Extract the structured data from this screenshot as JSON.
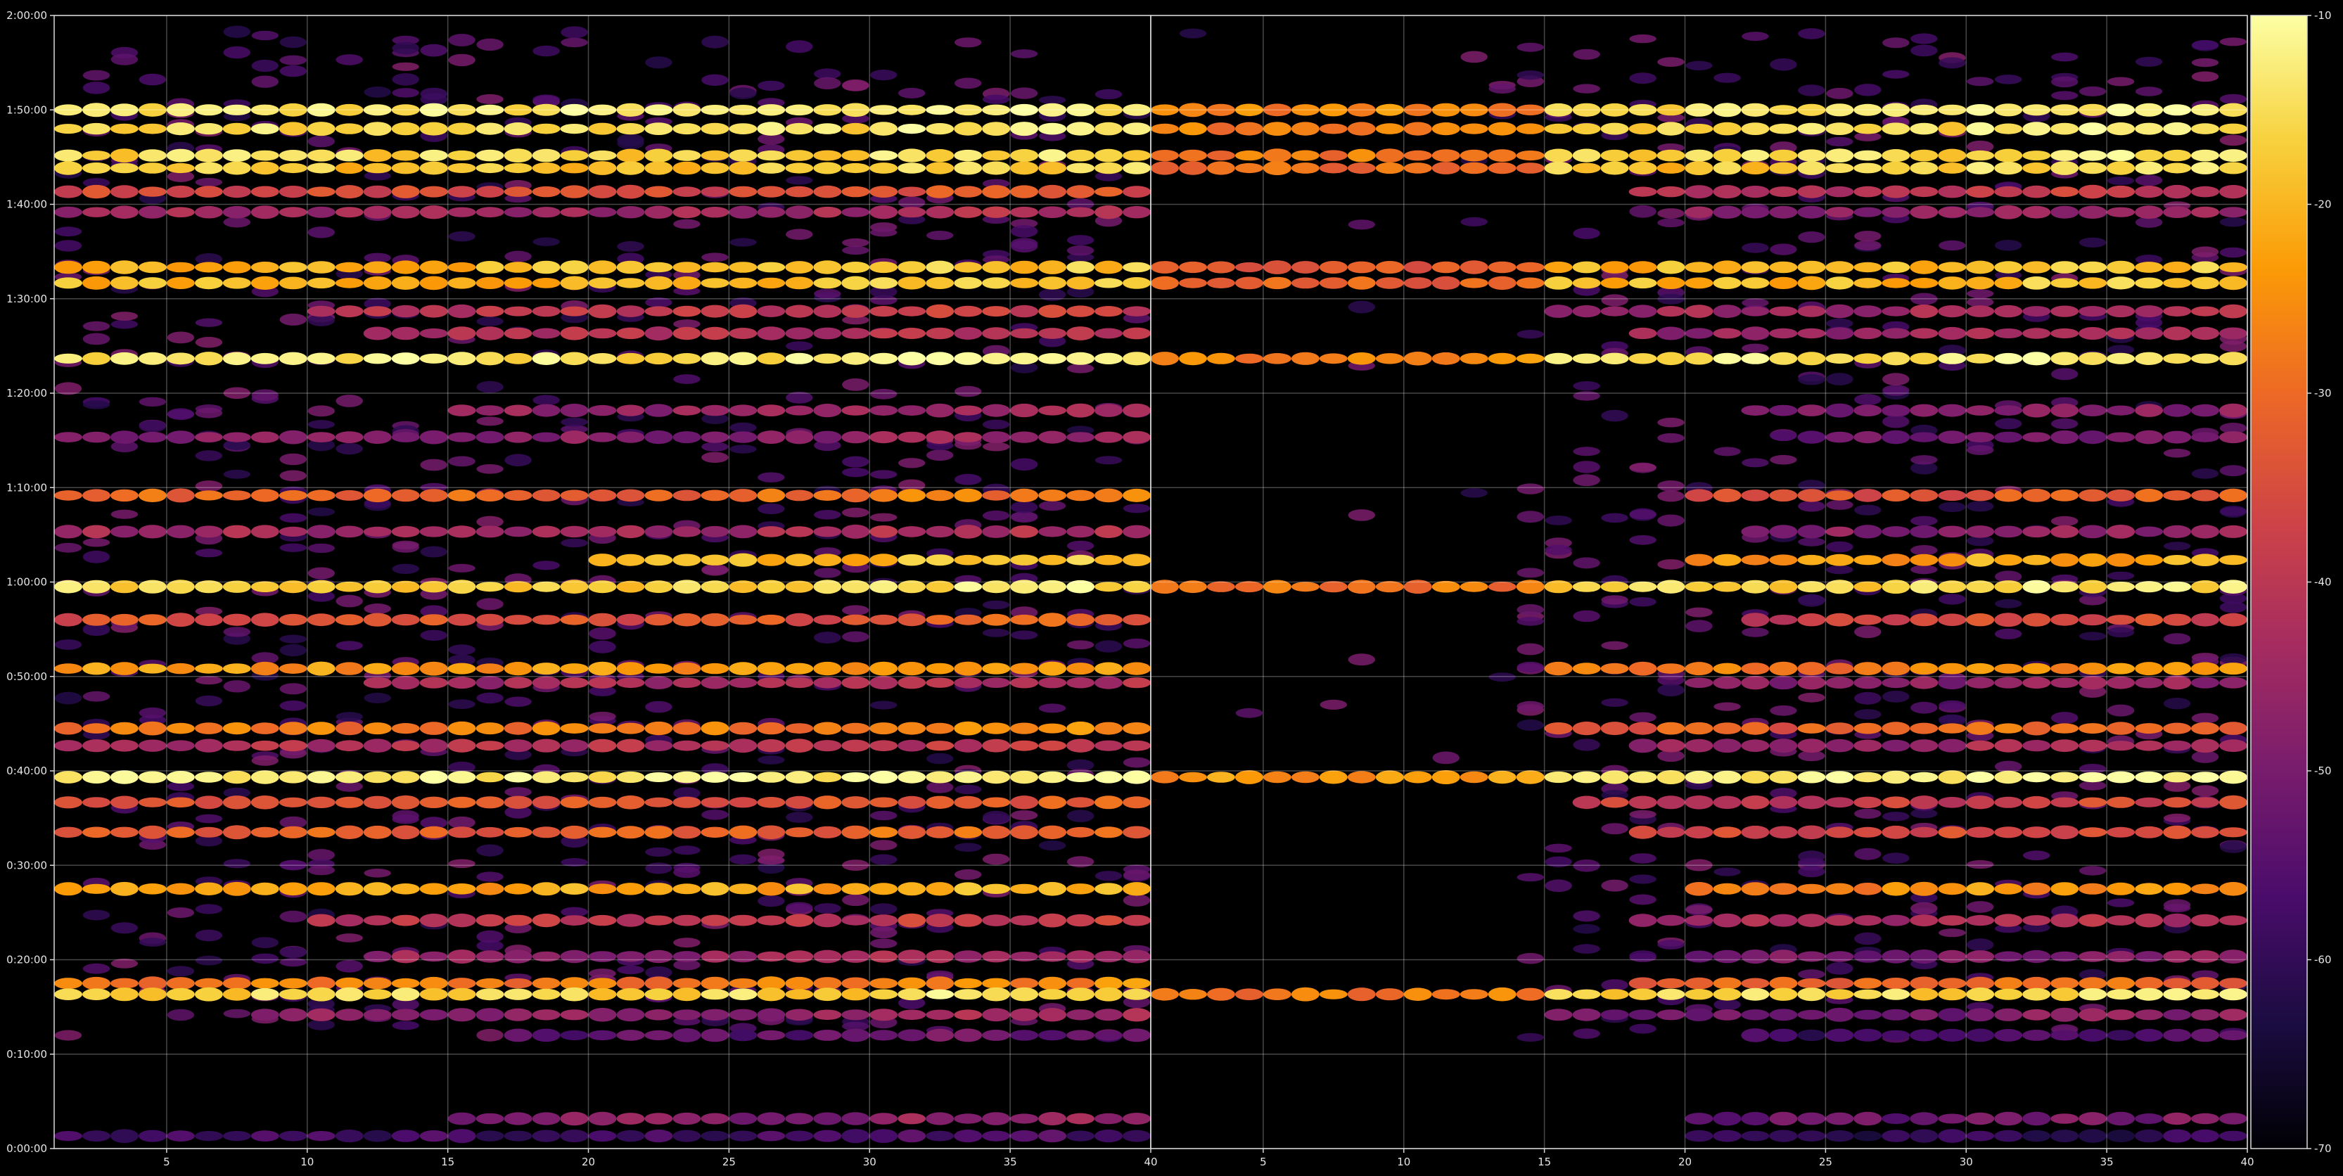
{
  "chart_data": {
    "type": "heatmap",
    "title": "",
    "xlabel": "",
    "ylabel": "",
    "grid": true,
    "colormap": "inferno",
    "colormap_stops": [
      "#000004",
      "#1b0c41",
      "#4a0c6b",
      "#781c6d",
      "#a52c60",
      "#cf4446",
      "#ed6925",
      "#fb9b06",
      "#f7d13d",
      "#fcffa4"
    ],
    "panels": [
      {
        "name": "left",
        "xlim": [
          1,
          40
        ],
        "xticks": [
          5,
          10,
          15,
          20,
          25,
          30,
          35,
          40
        ]
      },
      {
        "name": "right",
        "xlim": [
          1,
          40
        ],
        "xticks": [
          5,
          10,
          15,
          20,
          25,
          30,
          35,
          40
        ]
      }
    ],
    "ylim_seconds": [
      0,
      7200
    ],
    "yticks": [
      {
        "value": 0,
        "label": "0:00:00"
      },
      {
        "value": 600,
        "label": "0:10:00"
      },
      {
        "value": 1200,
        "label": "0:20:00"
      },
      {
        "value": 1800,
        "label": "0:30:00"
      },
      {
        "value": 2400,
        "label": "0:40:00"
      },
      {
        "value": 3000,
        "label": "0:50:00"
      },
      {
        "value": 3600,
        "label": "1:00:00"
      },
      {
        "value": 4200,
        "label": "1:10:00"
      },
      {
        "value": 4800,
        "label": "1:20:00"
      },
      {
        "value": 5400,
        "label": "1:30:00"
      },
      {
        "value": 6000,
        "label": "1:40:00"
      },
      {
        "value": 6600,
        "label": "1:50:00"
      },
      {
        "value": 7200,
        "label": "2:00:00"
      }
    ],
    "colorbar": {
      "range": [
        -70,
        -10
      ],
      "ticks": [
        -10,
        -20,
        -30,
        -40,
        -50,
        -60,
        -70
      ]
    },
    "bands": [
      {
        "t": 6600,
        "base": -14,
        "start": 1,
        "right_start": 1
      },
      {
        "t": 6480,
        "base": -15,
        "start": 1,
        "right_start": 1
      },
      {
        "t": 6310,
        "base": -16,
        "start": 1,
        "right_start": 1
      },
      {
        "t": 6230,
        "base": -18,
        "start": 1,
        "right_start": 1
      },
      {
        "t": 6080,
        "base": -36,
        "start": 1,
        "right_start": 18
      },
      {
        "t": 5950,
        "base": -44,
        "start": 1,
        "right_start": 20
      },
      {
        "t": 5600,
        "base": -20,
        "start": 1,
        "right_start": 1
      },
      {
        "t": 5500,
        "base": -20,
        "start": 1,
        "right_start": 1
      },
      {
        "t": 5320,
        "base": -40,
        "start": 10,
        "right_start": 15
      },
      {
        "t": 5180,
        "base": -42,
        "start": 12,
        "right_start": 18
      },
      {
        "t": 5020,
        "base": -14,
        "start": 1,
        "right_start": 1
      },
      {
        "t": 4690,
        "base": -46,
        "start": 15,
        "right_start": 22
      },
      {
        "t": 4520,
        "base": -48,
        "start": 1,
        "right_start": 24
      },
      {
        "t": 4150,
        "base": -30,
        "start": 1,
        "right_start": 20
      },
      {
        "t": 3920,
        "base": -44,
        "start": 1,
        "right_start": 22
      },
      {
        "t": 3740,
        "base": -20,
        "start": 20,
        "right_start": 20
      },
      {
        "t": 3570,
        "base": -16,
        "start": 1,
        "right_start": 1
      },
      {
        "t": 3360,
        "base": -34,
        "start": 1,
        "right_start": 22
      },
      {
        "t": 3050,
        "base": -24,
        "start": 1,
        "right_start": 15
      },
      {
        "t": 2960,
        "base": -44,
        "start": 12,
        "right_start": 20
      },
      {
        "t": 2670,
        "base": -28,
        "start": 1,
        "right_start": 15
      },
      {
        "t": 2560,
        "base": -42,
        "start": 1,
        "right_start": 18
      },
      {
        "t": 2360,
        "base": -12,
        "start": 1,
        "right_start": 1
      },
      {
        "t": 2200,
        "base": -34,
        "start": 1,
        "right_start": 16
      },
      {
        "t": 2010,
        "base": -32,
        "start": 1,
        "right_start": 18
      },
      {
        "t": 1650,
        "base": -22,
        "start": 1,
        "right_start": 20
      },
      {
        "t": 1450,
        "base": -40,
        "start": 10,
        "right_start": 18
      },
      {
        "t": 1220,
        "base": -46,
        "start": 12,
        "right_start": 20
      },
      {
        "t": 1050,
        "base": -28,
        "start": 1,
        "right_start": 18
      },
      {
        "t": 980,
        "base": -16,
        "start": 1,
        "right_start": 1
      },
      {
        "t": 850,
        "base": -46,
        "start": 8,
        "right_start": 15
      },
      {
        "t": 720,
        "base": -54,
        "start": 17,
        "right_start": 22
      },
      {
        "t": 190,
        "base": -48,
        "start": 15,
        "right_start": 20
      },
      {
        "t": 80,
        "base": -58,
        "start": 1,
        "right_start": 20
      }
    ]
  }
}
